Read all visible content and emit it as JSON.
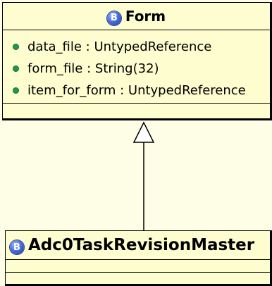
{
  "classes": {
    "form": {
      "stereotype_icon": "B",
      "name": "Form",
      "attributes": [
        "data_file : UntypedReference",
        "form_file : String(32)",
        "item_for_form : UntypedReference"
      ]
    },
    "adc": {
      "stereotype_icon": "B",
      "name": "Adc0TaskRevisionMaster"
    }
  },
  "relationship": {
    "type": "generalization",
    "from": "Adc0TaskRevisionMaster",
    "to": "Form"
  },
  "colors": {
    "class_fill": "#fdfdd0",
    "canvas": "#fefee6",
    "stereotype_icon": "#4c6fe0",
    "attribute_marker": "#1f9a4a"
  }
}
